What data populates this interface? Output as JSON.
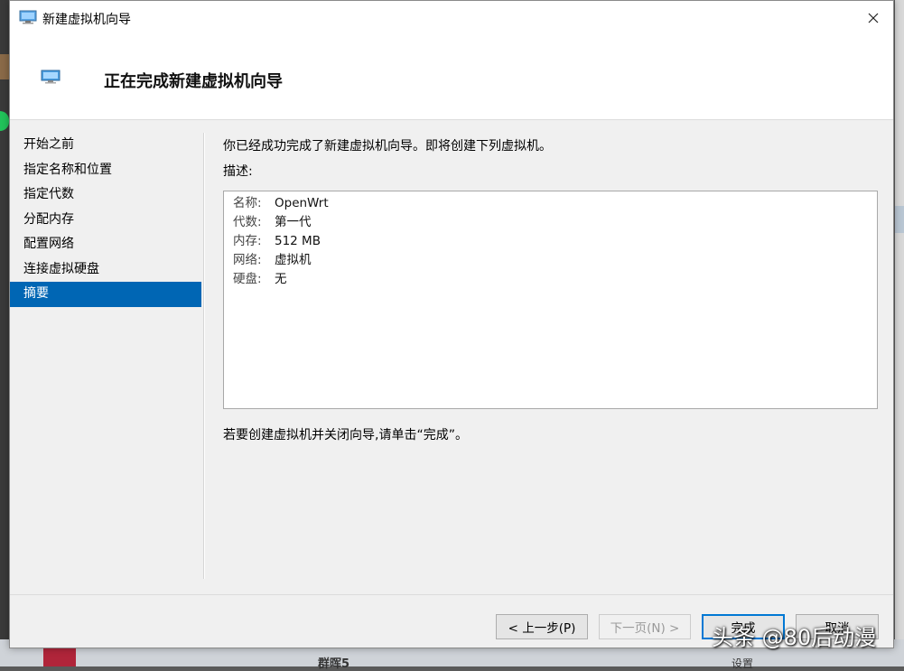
{
  "window": {
    "title": "新建虚拟机向导",
    "header_title": "正在完成新建虚拟机向导"
  },
  "nav": {
    "items": [
      {
        "label": "开始之前",
        "active": false
      },
      {
        "label": "指定名称和位置",
        "active": false
      },
      {
        "label": "指定代数",
        "active": false
      },
      {
        "label": "分配内存",
        "active": false
      },
      {
        "label": "配置网络",
        "active": false
      },
      {
        "label": "连接虚拟硬盘",
        "active": false
      },
      {
        "label": "摘要",
        "active": true
      }
    ]
  },
  "content": {
    "intro": "你已经成功完成了新建虚拟机向导。即将创建下列虚拟机。",
    "desc_label": "描述:",
    "summary": [
      {
        "key": "名称:",
        "value": "OpenWrt"
      },
      {
        "key": "代数:",
        "value": "第一代"
      },
      {
        "key": "内存:",
        "value": "512 MB"
      },
      {
        "key": "网络:",
        "value": "虚拟机"
      },
      {
        "key": "硬盘:",
        "value": "无"
      }
    ],
    "finish_hint": "若要创建虚拟机并关闭向导,请单击“完成”。"
  },
  "buttons": {
    "prev": "< 上一步(P)",
    "next": "下一页(N) >",
    "finish": "完成",
    "cancel": "取消"
  },
  "watermark": "头条 @80后动漫",
  "background": {
    "bottom_text": "群晖5",
    "bottom_text2": "设置"
  },
  "colors": {
    "accent": "#0066b4",
    "window_bg": "#f0f0f0"
  }
}
